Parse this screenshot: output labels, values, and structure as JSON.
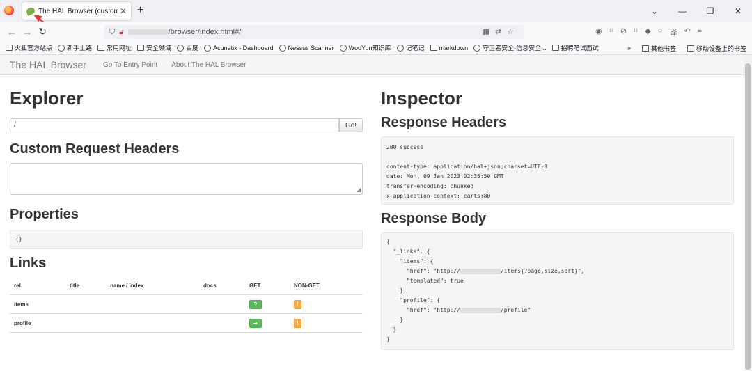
{
  "browser": {
    "tab_title": "The HAL Browser (customize",
    "url_path": "/browser/index.html#/",
    "bookmarks": [
      "火狐官方站点",
      "新手上路",
      "常用网址",
      "安全领域",
      "百度",
      "Acunetix - Dashboard",
      "Nessus Scanner",
      "WooYun知识库",
      "记笔记",
      "markdown",
      "守卫者安全-信息安全...",
      "招聘笔试面试"
    ],
    "bookmarks_right": [
      "其他书签",
      "移动设备上的书签"
    ]
  },
  "hal": {
    "brand": "The HAL Browser",
    "nav": [
      "Go To Entry Point",
      "About The HAL Browser"
    ],
    "explorer": {
      "title": "Explorer",
      "url_value": "/",
      "go_label": "Go!",
      "custom_headers_title": "Custom Request Headers",
      "properties_title": "Properties",
      "properties_value": "{}",
      "links_title": "Links",
      "columns": [
        "rel",
        "title",
        "name / index",
        "docs",
        "GET",
        "NON-GET"
      ],
      "rows": [
        {
          "rel": "items",
          "get_icon": "?"
        },
        {
          "rel": "profile",
          "get_icon": "➔"
        }
      ],
      "nonget_icon": "!"
    },
    "inspector": {
      "title": "Inspector",
      "response_headers_title": "Response Headers",
      "status": "200 success",
      "headers": [
        "content-type: application/hal+json;charset=UTF-8",
        "date: Mon, 09 Jan 2023 02:35:50 GMT",
        "transfer-encoding: chunked",
        "x-application-context: carts:80"
      ],
      "response_body_title": "Response Body",
      "body_lines": [
        "{",
        "  \"_links\": {",
        "    \"items\": {",
        "      \"href\": \"http://",
        "      \"templated\": true",
        "    },",
        "    \"profile\": {",
        "      \"href\": \"http://",
        "    }",
        "  }",
        "}"
      ],
      "items_href_suffix": "/items{?page,size,sort}\",",
      "profile_href_suffix": "/profile\""
    }
  }
}
